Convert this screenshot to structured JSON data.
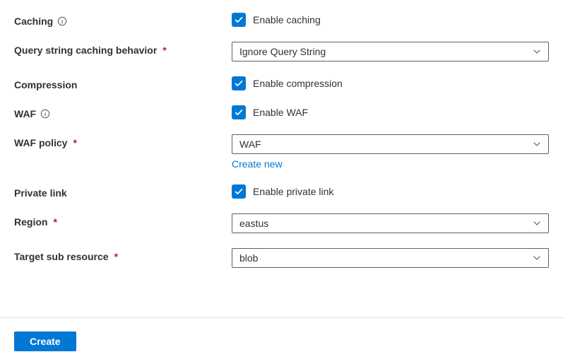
{
  "fields": {
    "caching": {
      "label": "Caching",
      "checkbox_label": "Enable caching",
      "checked": true
    },
    "query_string": {
      "label": "Query string caching behavior",
      "selected": "Ignore Query String"
    },
    "compression": {
      "label": "Compression",
      "checkbox_label": "Enable compression",
      "checked": true
    },
    "waf": {
      "label": "WAF",
      "checkbox_label": "Enable WAF",
      "checked": true
    },
    "waf_policy": {
      "label": "WAF policy",
      "selected": "WAF",
      "create_new": "Create new"
    },
    "private_link": {
      "label": "Private link",
      "checkbox_label": "Enable private link",
      "checked": true
    },
    "region": {
      "label": "Region",
      "selected": "eastus"
    },
    "target_sub": {
      "label": "Target sub resource",
      "selected": "blob"
    }
  },
  "footer": {
    "create_label": "Create"
  },
  "required_marker": "*"
}
